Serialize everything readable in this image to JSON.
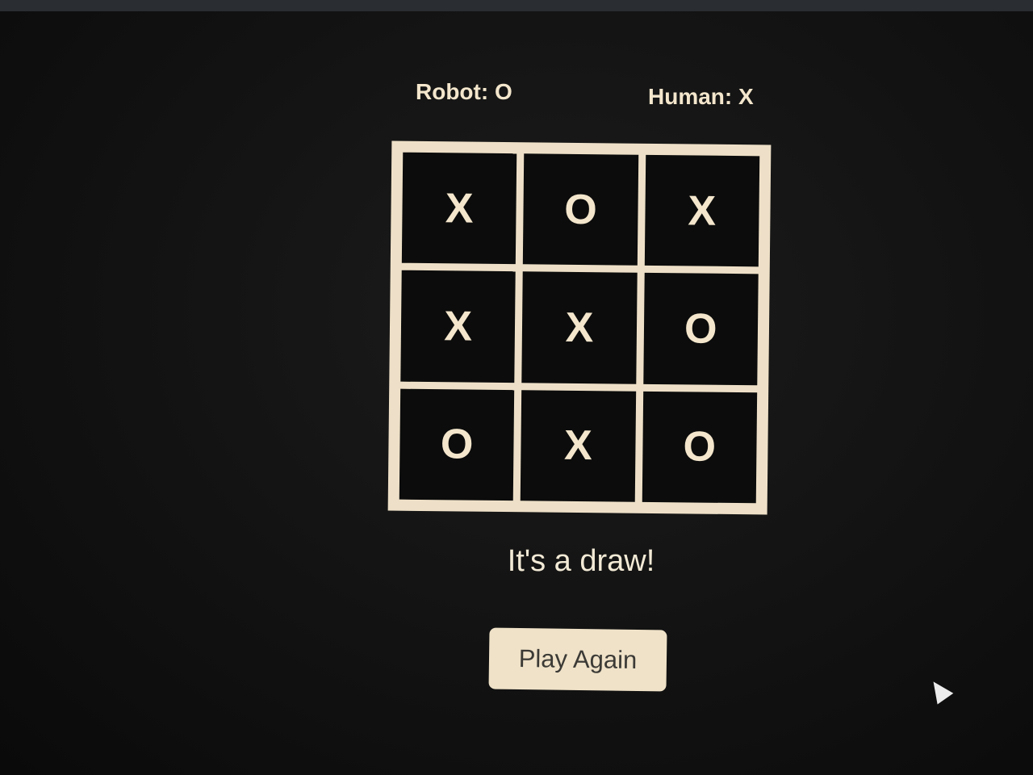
{
  "players": {
    "robot": "Robot: O",
    "human": "Human: X"
  },
  "board": {
    "cells": [
      "X",
      "O",
      "X",
      "X",
      "X",
      "O",
      "O",
      "X",
      "O"
    ]
  },
  "status": "It's a draw!",
  "play_again_label": "Play Again",
  "colors": {
    "background": "#121212",
    "accent": "#eee0c8",
    "cell": "#0c0c0c",
    "mark": "#f3e6cc"
  },
  "icons": {
    "cursor": "mouse-cursor-icon"
  }
}
